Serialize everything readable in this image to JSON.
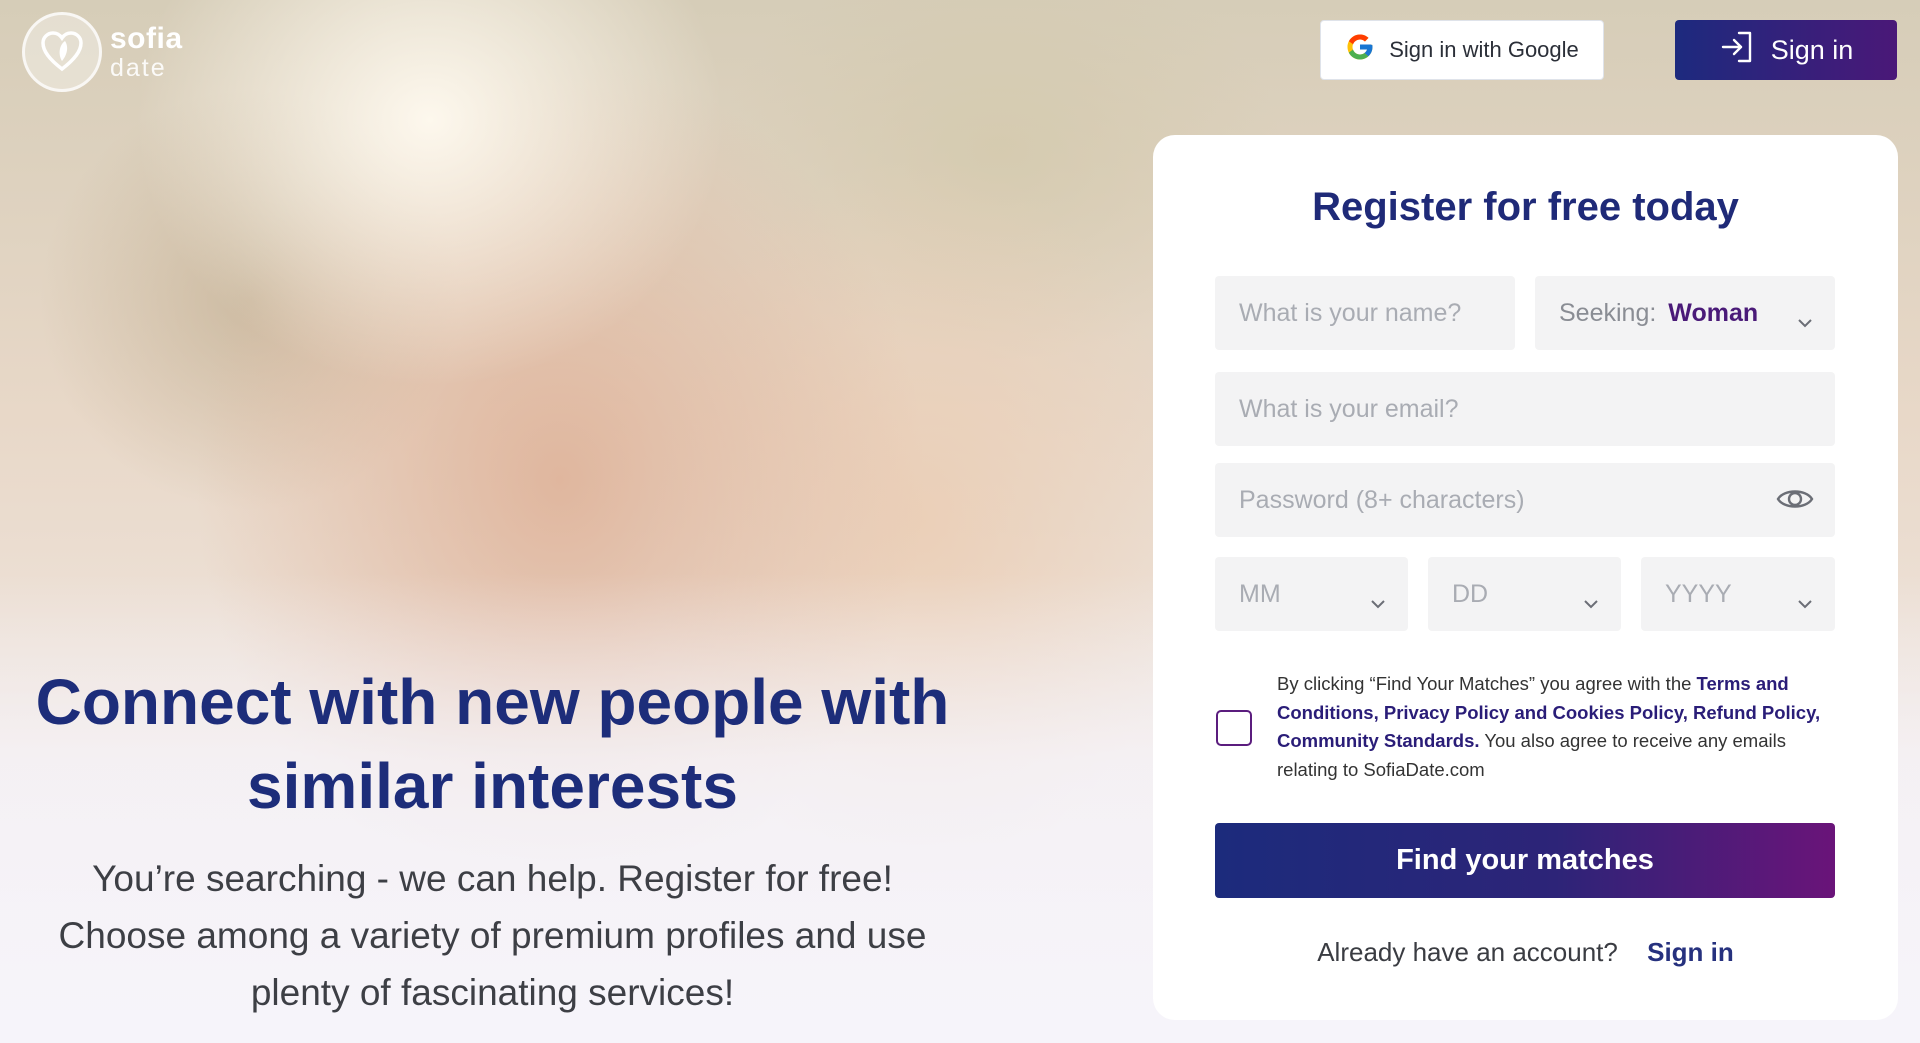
{
  "logo": {
    "line1": "sofia",
    "line2": "date"
  },
  "header": {
    "google_label": "Sign in with Google",
    "signin_label": "Sign in"
  },
  "hero": {
    "title_line1": "Connect with new people with",
    "title_line2": "similar interests",
    "sub_line1": "You’re searching - we can help. Register for free!",
    "sub_line2": "Choose among a variety of premium profiles and use",
    "sub_line3": "plenty of fascinating services!"
  },
  "form": {
    "title": "Register for free today",
    "name_placeholder": "What is your name?",
    "seeking_label": "Seeking:",
    "seeking_value": "Woman",
    "email_placeholder": "What is your email?",
    "password_placeholder": "Password (8+ characters)",
    "month_placeholder": "MM",
    "day_placeholder": "DD",
    "year_placeholder": "YYYY",
    "terms_prefix": "By clicking “Find Your Matches” you agree with the",
    "terms_link1": "Terms and Conditions,",
    "terms_link2": "Privacy Policy and Cookies Policy,",
    "terms_link3": "Refund Policy,",
    "terms_link4": "Community Standards.",
    "terms_suffix": "You also agree to receive any emails relating to SofiaDate.com",
    "submit_label": "Find your matches",
    "already_text": "Already have an account?",
    "signin_link": "Sign in"
  },
  "colors": {
    "brand_navy": "#1d2d7a",
    "brand_purple": "#4a1a78",
    "button_gradient_end": "#6a1479"
  },
  "icons": [
    "logo-heart-icon",
    "google-icon",
    "sign-in-icon",
    "chevron-down-icon",
    "eye-icon"
  ]
}
